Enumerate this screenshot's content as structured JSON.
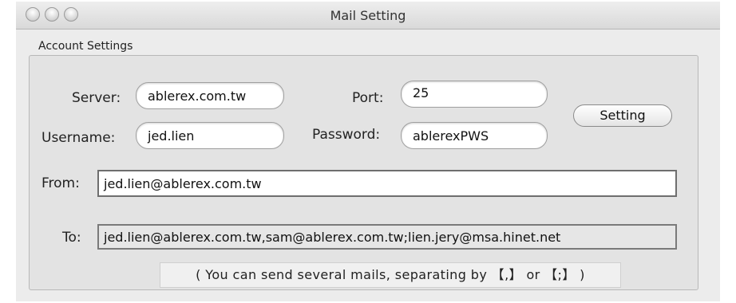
{
  "window": {
    "title": "Mail Setting"
  },
  "account_settings": {
    "group_label": "Account Settings",
    "server": {
      "label": "Server:",
      "value": "ablerex.com.tw"
    },
    "port": {
      "label": "Port:",
      "value": "25"
    },
    "username": {
      "label": "Username:",
      "value": "jed.lien"
    },
    "password": {
      "label": "Password:",
      "value": "ablerexPWS"
    },
    "setting_button": "Setting",
    "from": {
      "label": "From:",
      "value": "jed.lien@ablerex.com.tw"
    },
    "to": {
      "label": "To:",
      "value": "jed.lien@ablerex.com.tw,sam@ablerex.com.tw;lien.jery@msa.hinet.net"
    },
    "hint": "( You can send several mails, separating by 【,】 or 【;】 )"
  }
}
